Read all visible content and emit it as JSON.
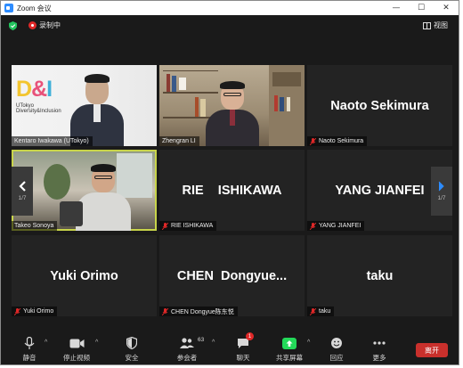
{
  "window": {
    "title": "Zoom 会议"
  },
  "topbar": {
    "recording_label": "录制中",
    "view_label": "视图"
  },
  "gallery": {
    "page_left": "1/7",
    "page_right": "1/7",
    "tiles": [
      {
        "name": "Kentaro Iwakawa (UTokyo)",
        "video": true
      },
      {
        "name": "Zhengran LI",
        "video": true
      },
      {
        "name": "Naoto Sekimura",
        "display": "Naoto Sekimura",
        "video": false
      },
      {
        "name": "Takeo Sonoya",
        "video": true
      },
      {
        "name": "RIE ISHIKAWA",
        "display": "RIE    ISHIKAWA",
        "video": false
      },
      {
        "name": "YANG JIANFEI",
        "display": "YANG JIANFEI",
        "video": false
      },
      {
        "name": "Yuki Orimo",
        "display": "Yuki Orimo",
        "video": false
      },
      {
        "name": "CHEN Dongyue陈东悦",
        "display": "CHEN  Dongyue...",
        "video": false
      },
      {
        "name": "taku",
        "display": "taku",
        "video": false
      }
    ],
    "logo": {
      "text": "D&I",
      "line1": "UTokyo",
      "line2": "Diversity&Inclusion"
    }
  },
  "toolbar": {
    "mute": "静音",
    "video": "停止视频",
    "security": "安全",
    "participants": "参会者",
    "participants_count": "63",
    "chat": "聊天",
    "chat_badge": "1",
    "share": "共享屏幕",
    "reactions": "回应",
    "more": "更多",
    "leave": "离开"
  },
  "colors": {
    "accent_blue": "#2d8cff",
    "share_green": "#23d959",
    "leave_red": "#c9302c",
    "active_speaker": "#c8d44a",
    "mic_off_red": "#e02828"
  }
}
